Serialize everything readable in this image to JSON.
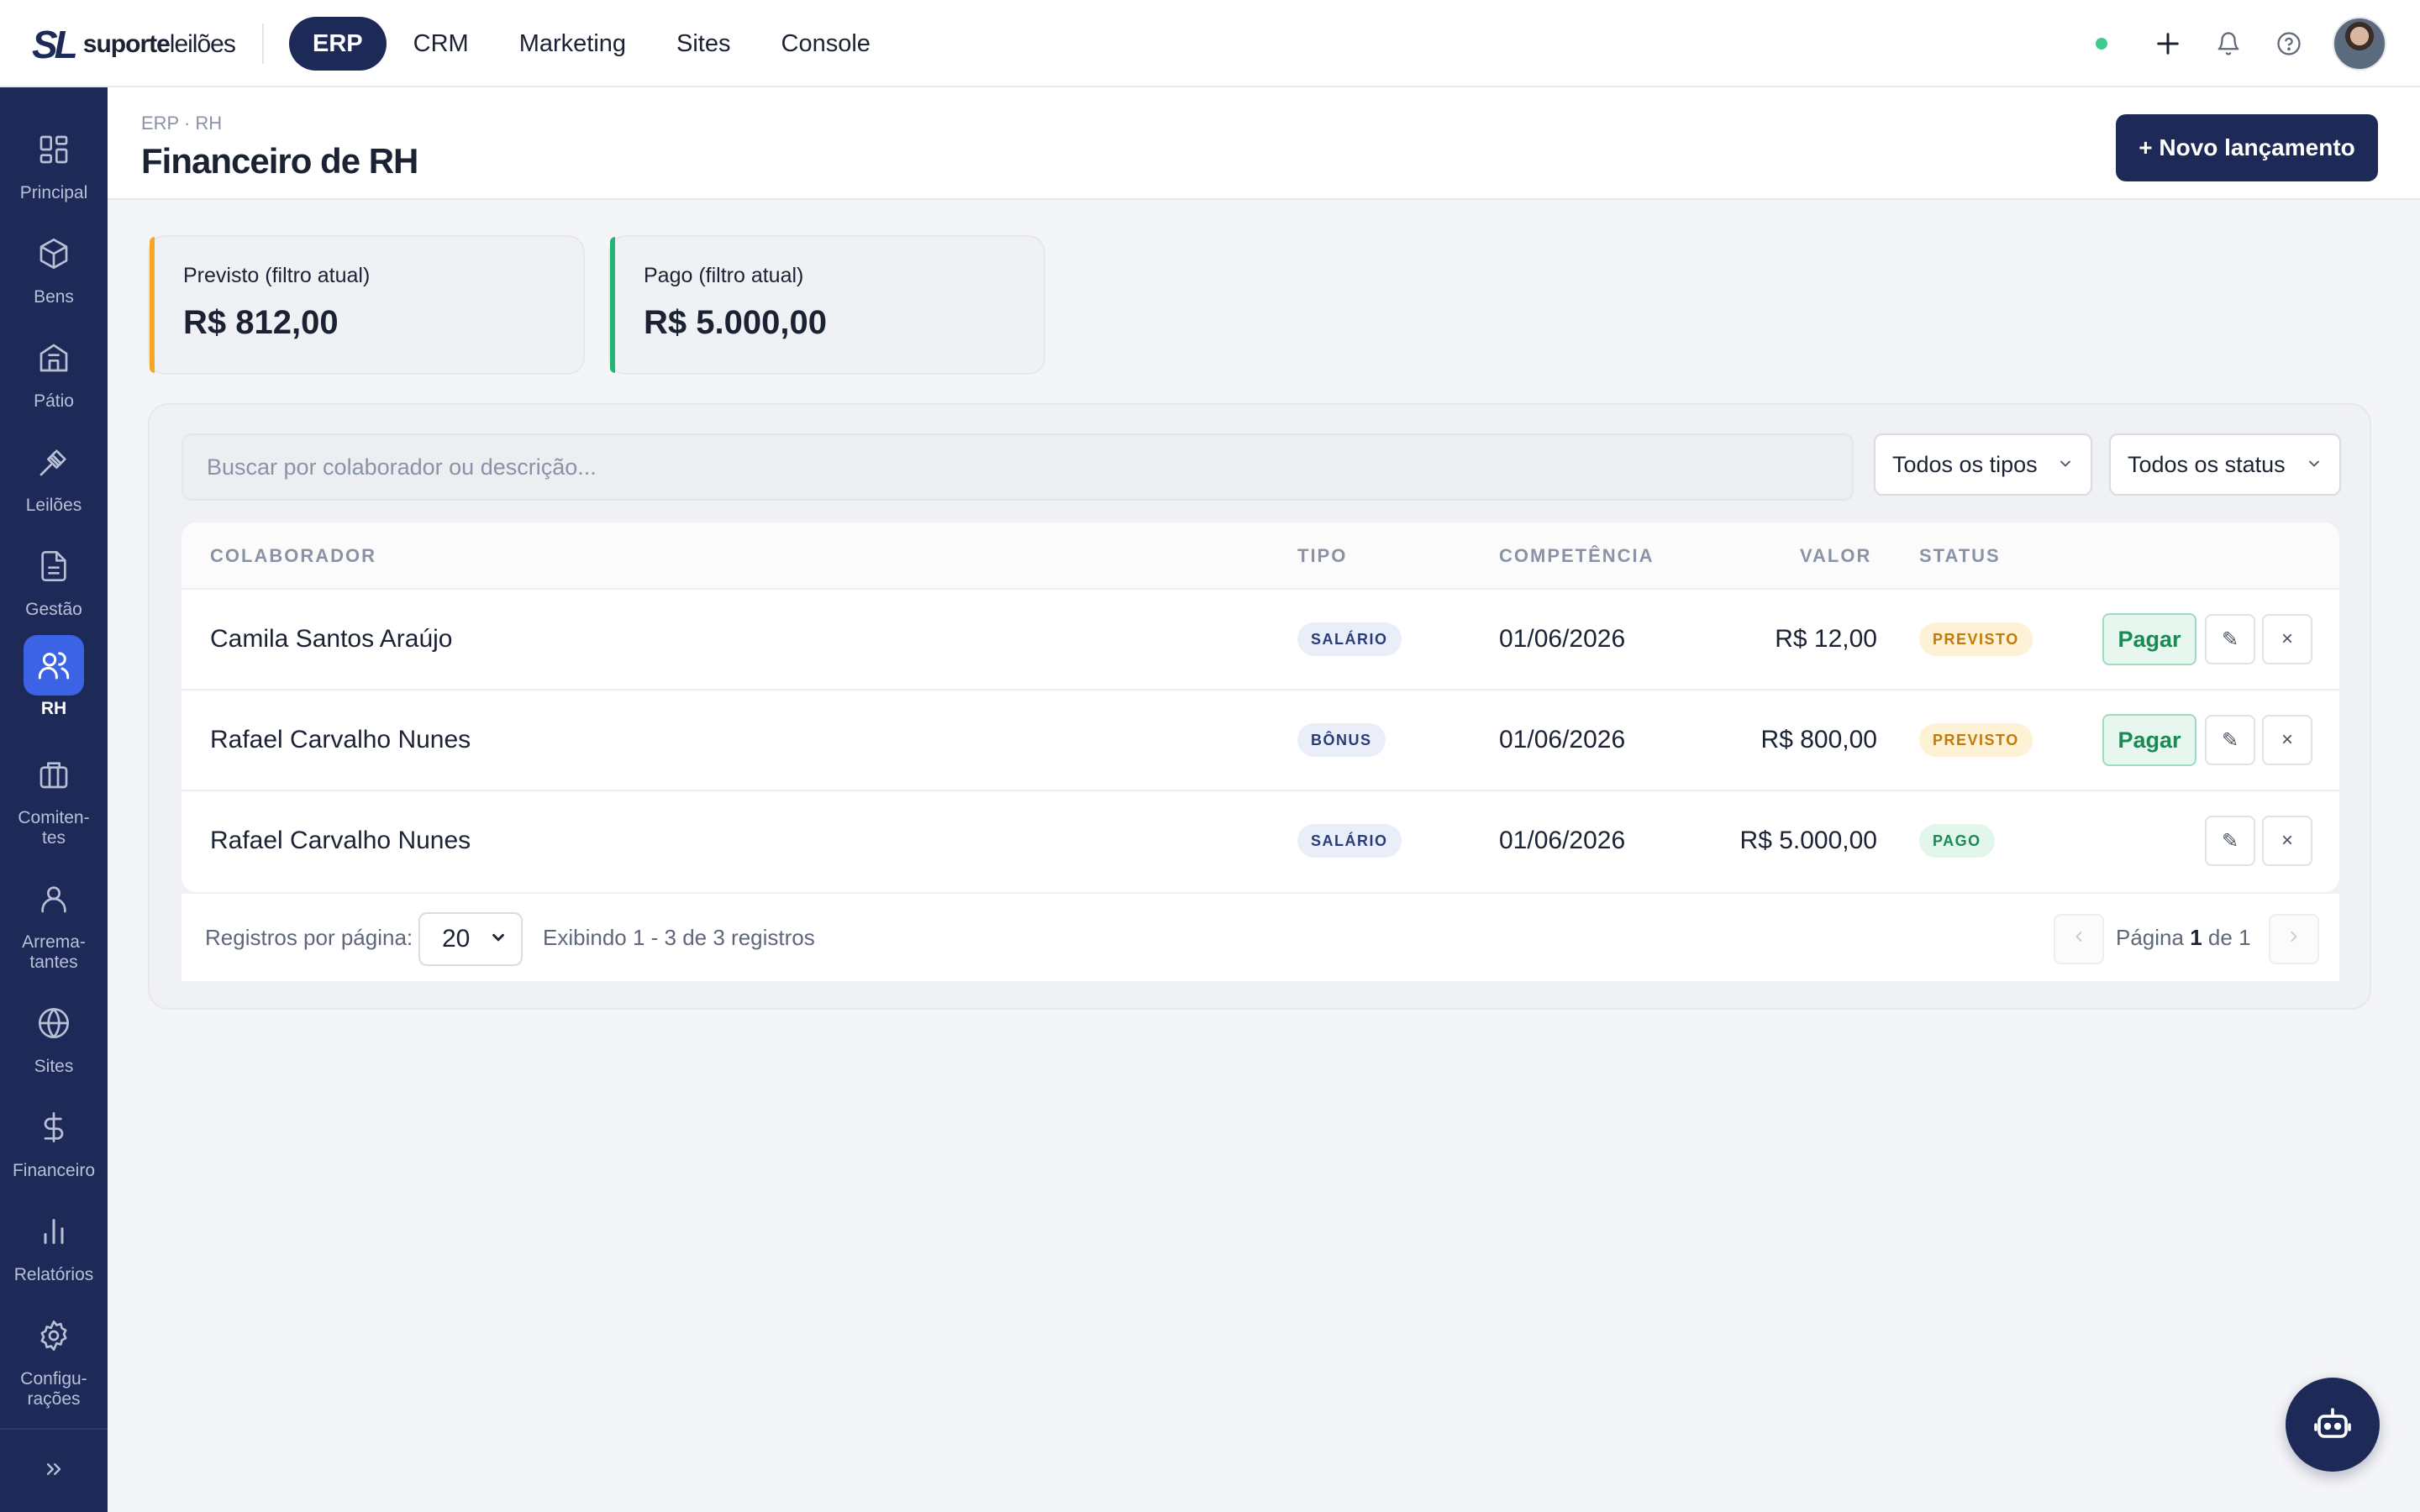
{
  "brand": {
    "mark": "SL",
    "name_bold": "suporte",
    "name_light": "leilões"
  },
  "topnav": {
    "tabs": [
      {
        "label": "ERP",
        "active": true
      },
      {
        "label": "CRM",
        "active": false
      },
      {
        "label": "Marketing",
        "active": false
      },
      {
        "label": "Sites",
        "active": false
      },
      {
        "label": "Console",
        "active": false
      }
    ],
    "icons": [
      "online-status-dot",
      "plus-icon",
      "bell-icon",
      "help-icon",
      "avatar"
    ]
  },
  "sidebar": {
    "items": [
      {
        "label": "Principal",
        "icon": "grid-icon"
      },
      {
        "label": "Bens",
        "icon": "cube-icon"
      },
      {
        "label": "Pátio",
        "icon": "building-icon"
      },
      {
        "label": "Leilões",
        "icon": "gavel-icon"
      },
      {
        "label": "Gestão",
        "icon": "document-icon"
      },
      {
        "label": "RH",
        "icon": "users-icon",
        "active": true
      },
      {
        "label": "Comiten-\ntes",
        "icon": "briefcase-icon"
      },
      {
        "label": "Arrema-\ntantes",
        "icon": "user-icon"
      },
      {
        "label": "Sites",
        "icon": "globe-icon"
      },
      {
        "label": "Financeiro",
        "icon": "dollar-icon"
      },
      {
        "label": "Relatórios",
        "icon": "bar-chart-icon"
      },
      {
        "label": "Configu-\nrações",
        "icon": "gear-icon"
      }
    ],
    "expand_icon": "chevrons-right-icon"
  },
  "header": {
    "breadcrumb": "ERP · RH",
    "title": "Financeiro de RH",
    "new_button": "+ Novo lançamento"
  },
  "summary": {
    "previsto": {
      "label": "Previsto (filtro atual)",
      "value": "R$ 812,00",
      "color": "#f5a623"
    },
    "pago": {
      "label": "Pago (filtro atual)",
      "value": "R$ 5.000,00",
      "color": "#22b573"
    }
  },
  "filters": {
    "search_placeholder": "Buscar por colaborador ou descrição...",
    "type_select": "Todos os tipos",
    "status_select": "Todos os status"
  },
  "table": {
    "headers": {
      "colaborador": "COLABORADOR",
      "tipo": "TIPO",
      "competencia": "COMPETÊNCIA",
      "valor": "VALOR",
      "status": "STATUS"
    },
    "rows": [
      {
        "colaborador": "Camila Santos Araújo",
        "tipo": "SALÁRIO",
        "competencia": "01/06/2026",
        "valor": "R$ 12,00",
        "status": "PREVISTO",
        "pay": "Pagar"
      },
      {
        "colaborador": "Rafael Carvalho Nunes",
        "tipo": "BÔNUS",
        "competencia": "01/06/2026",
        "valor": "R$ 800,00",
        "status": "PREVISTO",
        "pay": "Pagar"
      },
      {
        "colaborador": "Rafael Carvalho Nunes",
        "tipo": "SALÁRIO",
        "competencia": "01/06/2026",
        "valor": "R$ 5.000,00",
        "status": "PAGO",
        "pay": ""
      }
    ],
    "edit_glyph": "✎",
    "delete_glyph": "×"
  },
  "pagination": {
    "per_page_label": "Registros por página:",
    "per_page_value": "20",
    "showing": "Exibindo 1 - 3 de 3 registros",
    "page_prefix": "Página",
    "page_current": "1",
    "page_mid": "de",
    "page_total": "1"
  },
  "colors": {
    "navy": "#1d2a57",
    "accent": "#3c63e6",
    "previsto": "#f5a623",
    "pago": "#22b573"
  }
}
